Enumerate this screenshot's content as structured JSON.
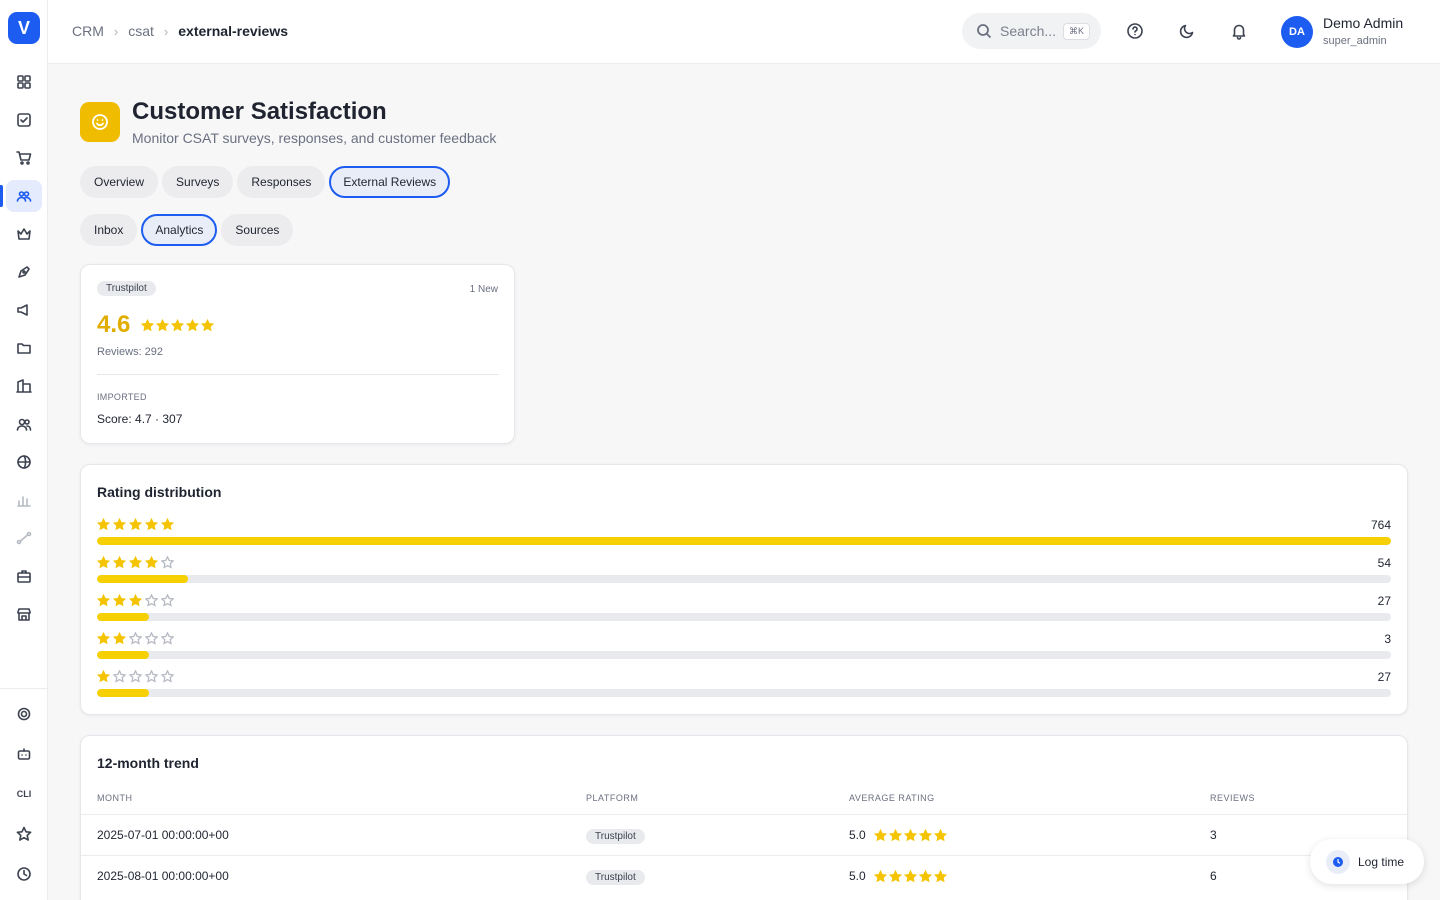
{
  "sidebar": {
    "logo": "V",
    "icons": [
      "dashboard-icon",
      "tasks-icon",
      "cart-icon",
      "users-icon",
      "crown-icon",
      "pen-icon",
      "megaphone-icon",
      "folder-icon",
      "building-icon",
      "team-icon",
      "globe-icon",
      "chart-icon",
      "route-icon",
      "briefcase-icon",
      "store-icon",
      "settings-icon",
      "bot-icon",
      "cli-icon",
      "star-icon",
      "clock-icon"
    ],
    "cli_label": "CLI",
    "active_icon": "users-icon"
  },
  "topbar": {
    "breadcrumb": [
      "CRM",
      "csat",
      "external-reviews"
    ],
    "search_placeholder": "Search...",
    "search_shortcut": "⌘K",
    "user_initials": "DA",
    "user_name": "Demo Admin",
    "user_role": "super_admin"
  },
  "header": {
    "title": "Customer Satisfaction",
    "subtitle": "Monitor CSAT surveys, responses, and customer feedback"
  },
  "tabs": [
    "Overview",
    "Surveys",
    "Responses",
    "External Reviews"
  ],
  "active_tab": "External Reviews",
  "subtabs": [
    "Inbox",
    "Analytics",
    "Sources"
  ],
  "active_subtab": "Analytics",
  "platform_card": {
    "platform": "Trustpilot",
    "new_label": "1 New",
    "score": "4.6",
    "stars": 5,
    "reviews": "Reviews: 292",
    "imported_label": "IMPORTED",
    "imported_score": "Score: 4.7 · 307"
  },
  "distribution": {
    "title": "Rating distribution",
    "rows": [
      {
        "stars": 5,
        "count": "764",
        "fill": 1.0
      },
      {
        "stars": 4,
        "count": "54",
        "fill": 0.07
      },
      {
        "stars": 3,
        "count": "27",
        "fill": 0.04
      },
      {
        "stars": 2,
        "count": "3",
        "fill": 0.04
      },
      {
        "stars": 1,
        "count": "27",
        "fill": 0.04
      }
    ]
  },
  "trend": {
    "title": "12-month trend",
    "columns": [
      "MONTH",
      "PLATFORM",
      "AVERAGE RATING",
      "REVIEWS"
    ],
    "rows": [
      {
        "month": "2025-07-01 00:00:00+00",
        "platform": "Trustpilot",
        "rating": "5.0",
        "stars": 5,
        "reviews": "3"
      },
      {
        "month": "2025-08-01 00:00:00+00",
        "platform": "Trustpilot",
        "rating": "5.0",
        "stars": 5,
        "reviews": "6"
      }
    ]
  },
  "log_time": "Log time",
  "colors": {
    "accent": "#1d5cf0",
    "star": "#f4c400",
    "page_icon": "#f0bc00",
    "bar_fill": "#f6d000"
  }
}
